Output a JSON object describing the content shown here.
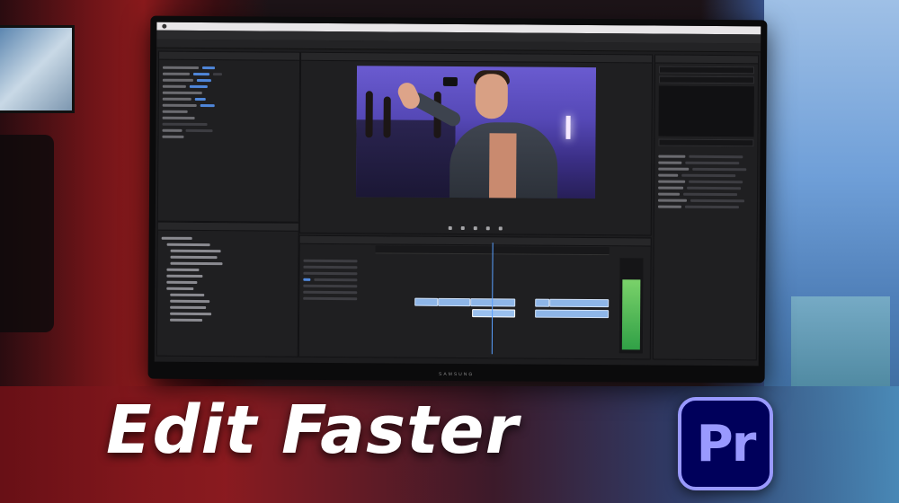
{
  "overlay": {
    "headline": "Edit Faster",
    "logo_text": "Pr"
  },
  "monitor": {
    "brand": "SAMSUNG"
  },
  "colors": {
    "accent": "#5aa0ff",
    "logo_bg": "#00005b",
    "logo_fg": "#9999ff",
    "meter_green": "#30a046"
  },
  "icons": [
    "apple-icon",
    "play-icon",
    "camera-icon"
  ]
}
